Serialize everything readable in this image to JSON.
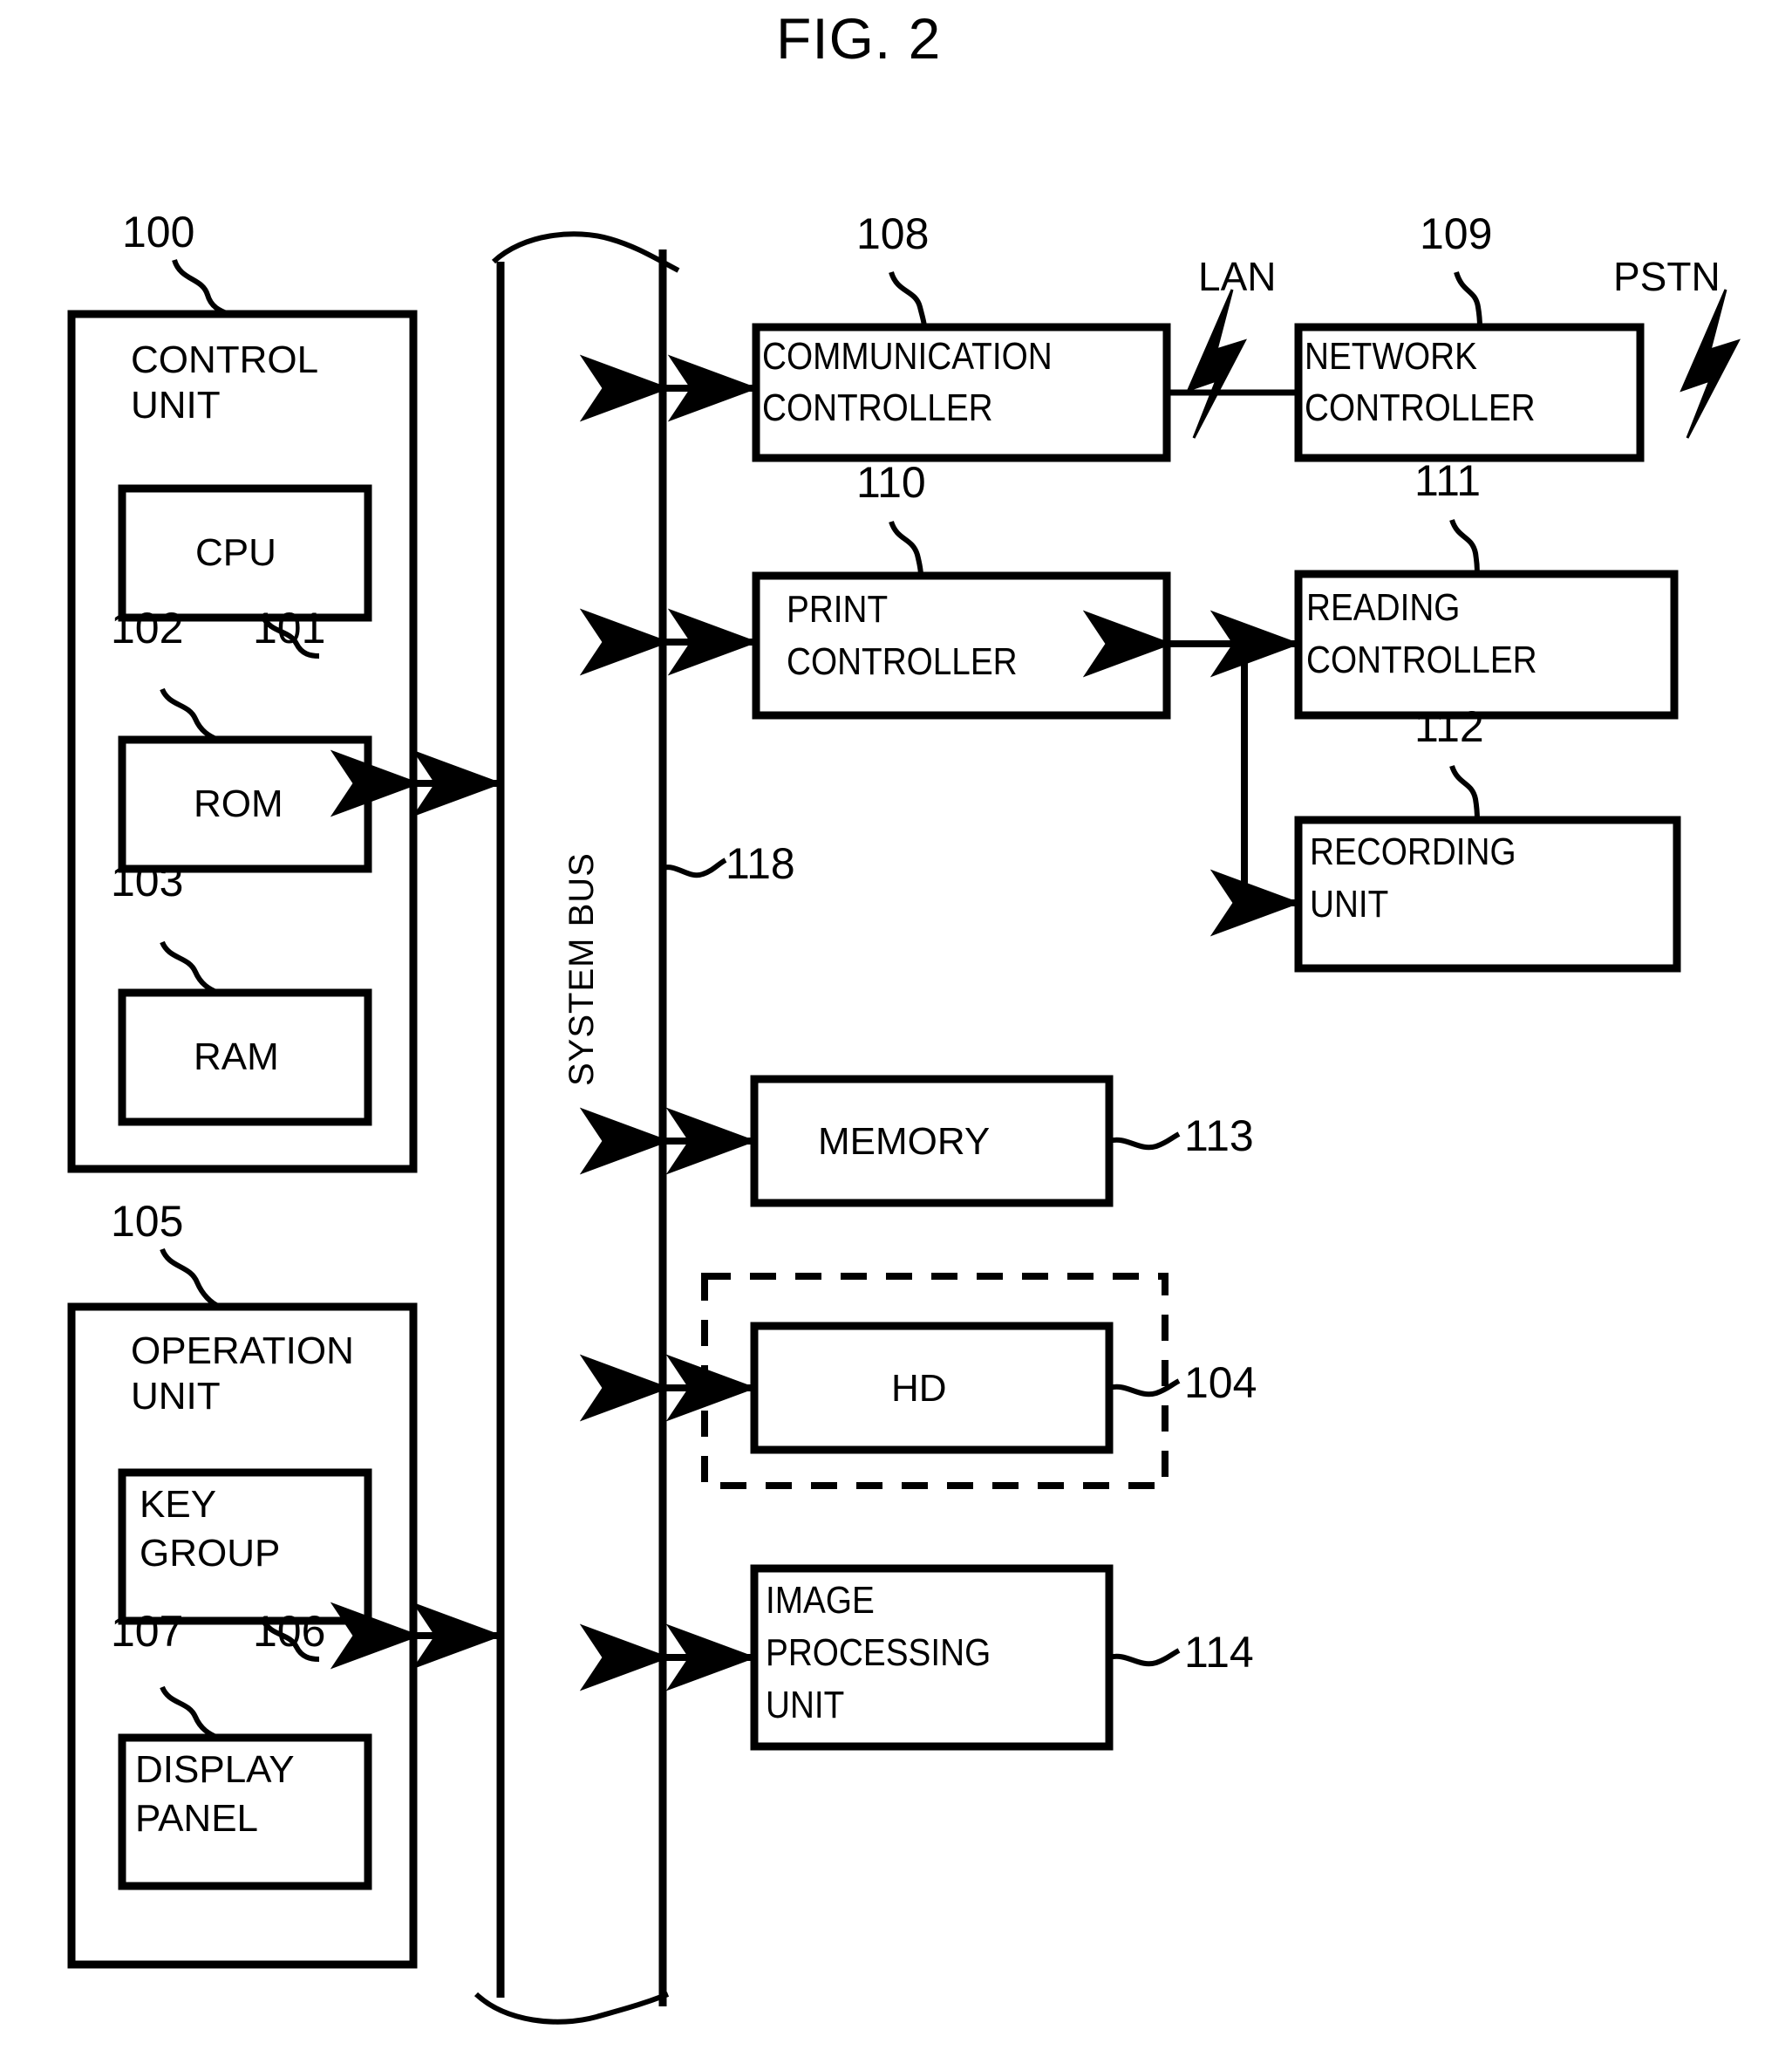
{
  "figure": {
    "title": "FIG. 2",
    "type": "block-diagram",
    "background": "#ffffff",
    "line_color": "#000000"
  },
  "bus": {
    "label": "SYSTEM BUS",
    "ref": "118"
  },
  "control_unit": {
    "ref": "100",
    "title_line1": "CONTROL",
    "title_line2": "UNIT",
    "children": [
      {
        "ref": "101",
        "label": "CPU"
      },
      {
        "ref": "102",
        "label": "ROM"
      },
      {
        "ref": "103",
        "label": "RAM"
      }
    ]
  },
  "operation_unit": {
    "ref": "105",
    "title_line1": "OPERATION",
    "title_line2": "UNIT",
    "children": [
      {
        "ref": "106",
        "label_line1": "KEY",
        "label_line2": "GROUP"
      },
      {
        "ref": "107",
        "label_line1": "DISPLAY",
        "label_line2": "PANEL"
      }
    ]
  },
  "right_blocks": [
    {
      "ref": "108",
      "label_line1": "COMMUNICATION",
      "label_line2": "CONTROLLER"
    },
    {
      "ref": "109",
      "label_line1": "NETWORK",
      "label_line2": "CONTROLLER"
    },
    {
      "ref": "110",
      "label_line1": "PRINT",
      "label_line2": "CONTROLLER"
    },
    {
      "ref": "111",
      "label_line1": "READING",
      "label_line2": "CONTROLLER"
    },
    {
      "ref": "112",
      "label_line1": "RECORDING",
      "label_line2": "UNIT"
    },
    {
      "ref": "113",
      "label_line1": "MEMORY",
      "label_line2": ""
    },
    {
      "ref": "104",
      "label_line1": "HD",
      "label_line2": ""
    },
    {
      "ref": "114",
      "label_line1": "IMAGE",
      "label_line2": "PROCESSING",
      "label_line3": "UNIT"
    }
  ],
  "external_links": [
    {
      "name": "LAN",
      "label": "LAN",
      "symbol": "lightning-bolt"
    },
    {
      "name": "PSTN",
      "label": "PSTN",
      "symbol": "lightning-bolt"
    }
  ]
}
